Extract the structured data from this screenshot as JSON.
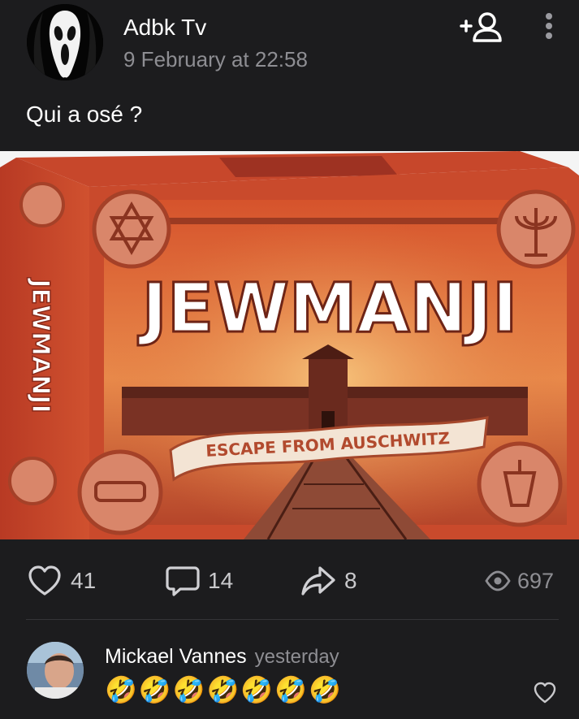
{
  "post": {
    "author": "Adbk Tv",
    "date": "9 February at 22:58",
    "text": "Qui a osé ?",
    "image": {
      "title": "JEWMANJI",
      "side_title": "JEWMANJI",
      "banner": "ESCAPE FROM AUSCHWITZ"
    },
    "likes": "41",
    "comments": "14",
    "shares": "8",
    "views": "697"
  },
  "comment": {
    "author": "Mickael Vannes",
    "time": "yesterday",
    "text": "🤣🤣🤣🤣🤣🤣🤣"
  },
  "icons": {
    "follow": "add-user-icon",
    "more": "more-vertical-icon",
    "like": "heart-icon",
    "comment": "comment-icon",
    "share": "share-icon",
    "views": "eye-icon"
  },
  "colors": {
    "background": "#1c1c1e",
    "muted": "#8e8e93",
    "box_red": "#c8452a"
  }
}
